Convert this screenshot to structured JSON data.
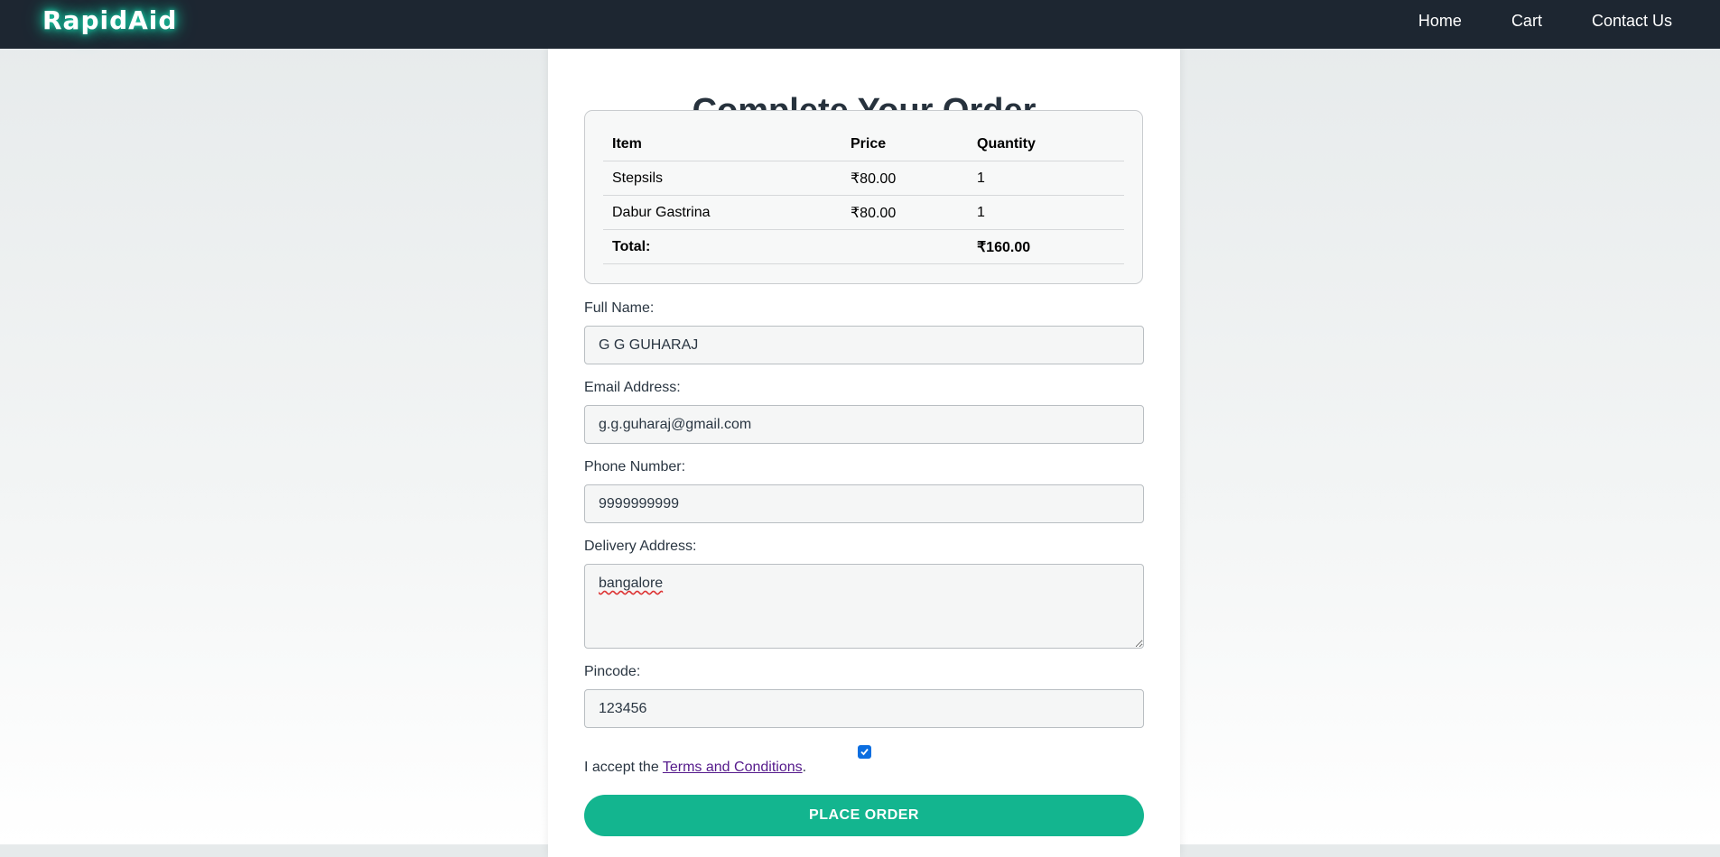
{
  "header": {
    "brand": "RapidAid",
    "nav": [
      "Home",
      "Cart",
      "Contact Us"
    ]
  },
  "page_title": "Complete Your Order",
  "order_summary": {
    "headers": [
      "Item",
      "Price",
      "Quantity"
    ],
    "rows": [
      {
        "item": "Stepsils",
        "price": "₹80.00",
        "quantity": "1"
      },
      {
        "item": "Dabur Gastrina",
        "price": "₹80.00",
        "quantity": "1"
      }
    ],
    "total_label": "Total:",
    "total_value": "₹160.00"
  },
  "form": {
    "full_name_label": "Full Name:",
    "full_name_value": "G G GUHARAJ",
    "email_label": "Email Address:",
    "email_value": "g.g.guharaj@gmail.com",
    "phone_label": "Phone Number:",
    "phone_value": "9999999999",
    "address_label": "Delivery Address:",
    "address_value": "bangalore",
    "pincode_label": "Pincode:",
    "pincode_value": "123456",
    "terms_checked": true,
    "terms_prefix": "I accept the",
    "terms_link": "Terms and Conditions",
    "terms_suffix": ".",
    "submit_label": "PLACE ORDER"
  },
  "colors": {
    "navbar": "#1d2631",
    "brand_glow": "#19c9a4",
    "accent": "#13b58f",
    "checkbox": "#0b6ee0"
  }
}
